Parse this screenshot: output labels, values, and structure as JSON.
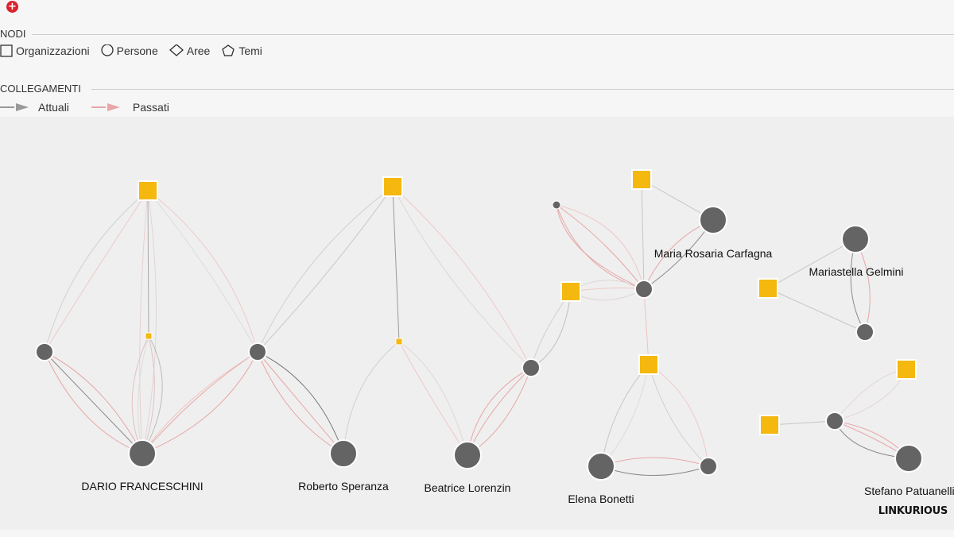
{
  "toolbar": {
    "add_icon": "plus-circle-icon",
    "add_symbol": "+"
  },
  "legend": {
    "nodes_title": "NODI",
    "node_types": [
      {
        "label": "Organizzazioni",
        "icon": "square-icon"
      },
      {
        "label": "Persone",
        "icon": "circle-icon"
      },
      {
        "label": "Aree",
        "icon": "diamond-icon"
      },
      {
        "label": "Temi",
        "icon": "pentagon-icon"
      }
    ],
    "links_title": "COLLEGAMENTI",
    "link_types": [
      {
        "label": "Attuali",
        "color": "#999999"
      },
      {
        "label": "Passati",
        "color": "#e8a6a6"
      }
    ]
  },
  "graph": {
    "person_color": "#646464",
    "org_color": "#f4b80f",
    "labels": {
      "franceschini": "DARIO FRANCESCHINI",
      "speranza": "Roberto Speranza",
      "lorenzin": "Beatrice Lorenzin",
      "carfagna": "Maria Rosaria Carfagna",
      "gelmini": "Mariastella Gelmini",
      "bonetti": "Elena Bonetti",
      "patuanelli": "Stefano Patuanelli"
    }
  },
  "branding": {
    "logo": "LINKURIOUS"
  }
}
